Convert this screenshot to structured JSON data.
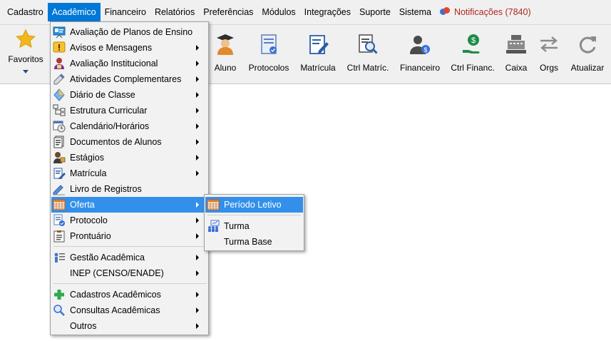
{
  "menubar": {
    "items": [
      {
        "label": "Cadastro"
      },
      {
        "label": "Acadêmico"
      },
      {
        "label": "Financeiro"
      },
      {
        "label": "Relatórios"
      },
      {
        "label": "Preferências"
      },
      {
        "label": "Módulos"
      },
      {
        "label": "Integrações"
      },
      {
        "label": "Suporte"
      },
      {
        "label": "Sistema"
      }
    ],
    "active_item": "Acadêmico",
    "notifications_label": "Notificações (7840)",
    "notifications_color": "#b0281d"
  },
  "toolbar": {
    "favorites_label": "Favoritos",
    "buttons": [
      {
        "label": "Aluno",
        "icon": "student-icon"
      },
      {
        "label": "Protocolos",
        "icon": "protocol-document-icon"
      },
      {
        "label": "Matrícula",
        "icon": "enrollment-edit-icon"
      },
      {
        "label": "Ctrl Matríc.",
        "icon": "enrollment-search-icon"
      },
      {
        "label": "Financeiro",
        "icon": "finance-person-icon"
      },
      {
        "label": "Ctrl Financ.",
        "icon": "money-hand-icon"
      },
      {
        "label": "Caixa",
        "icon": "cash-register-icon"
      },
      {
        "label": "Orgs",
        "icon": "swap-arrows-icon"
      },
      {
        "label": "Atualizar",
        "icon": "refresh-icon"
      }
    ]
  },
  "academic_menu": {
    "items": [
      {
        "label": "Avaliação de Planos de Ensino",
        "icon": "presentation-board-icon",
        "submenu": false
      },
      {
        "label": "Avisos e Mensagens",
        "icon": "warning-note-icon",
        "submenu": true
      },
      {
        "label": "Avaliação Institucional",
        "icon": "evaluation-person-icon",
        "submenu": true
      },
      {
        "label": "Atividades Complementares",
        "icon": "pencil-ruler-icon",
        "submenu": true
      },
      {
        "label": "Diário de Classe",
        "icon": "diary-diamond-icon",
        "submenu": true
      },
      {
        "label": "Estrutura Curricular",
        "icon": "hierarchy-icon",
        "submenu": true
      },
      {
        "label": "Calendário/Horários",
        "icon": "calendar-clock-icon",
        "submenu": true
      },
      {
        "label": "Documentos de Alunos",
        "icon": "documents-icon",
        "submenu": true
      },
      {
        "label": "Estágios",
        "icon": "internship-icon",
        "submenu": true
      },
      {
        "label": "Matrícula",
        "icon": "enrollment-edit-icon",
        "submenu": true
      },
      {
        "label": "Livro de Registros",
        "icon": "pen-book-icon",
        "submenu": false
      },
      {
        "label": "Oferta",
        "icon": "offer-calendar-icon",
        "submenu": true
      },
      {
        "label": "Protocolo",
        "icon": "protocol-icon",
        "submenu": true
      },
      {
        "label": "Prontuário",
        "icon": "clipboard-icon",
        "submenu": true
      },
      {
        "label": "Gestão Acadêmica",
        "icon": "management-people-icon",
        "submenu": true
      },
      {
        "label": "INEP (CENSO/ENADE)",
        "icon": "",
        "submenu": true
      },
      {
        "label": "Cadastros Acadêmicos",
        "icon": "green-plus-icon",
        "submenu": true
      },
      {
        "label": "Consultas Acadêmicas",
        "icon": "magnifier-icon",
        "submenu": true
      },
      {
        "label": "Outros",
        "icon": "",
        "submenu": true
      }
    ],
    "highlighted": "Oferta"
  },
  "oferta_submenu": {
    "items": [
      {
        "label": "Período Letivo",
        "icon": "offer-calendar-icon"
      },
      {
        "label": "Turma",
        "icon": "class-group-icon"
      },
      {
        "label": "Turma Base",
        "icon": ""
      }
    ],
    "highlighted": "Período Letivo"
  },
  "colors": {
    "menu_highlight": "#3390ea",
    "menubar_active": "#0078d7"
  }
}
